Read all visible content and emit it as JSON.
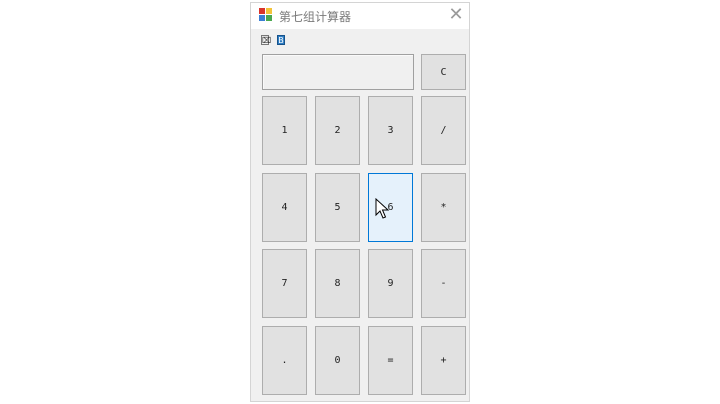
{
  "window": {
    "title": "第七组计算器",
    "close_symbol": "✕"
  },
  "menu": {
    "items": [
      "⌧",
      "B"
    ]
  },
  "display": {
    "value": ""
  },
  "clear_button": {
    "label": "C"
  },
  "keypad": {
    "rows": [
      [
        "1",
        "2",
        "3",
        "/"
      ],
      [
        "4",
        "5",
        "6",
        "*"
      ],
      [
        "7",
        "8",
        "9",
        "-"
      ],
      [
        ".",
        "0",
        "=",
        "+"
      ]
    ],
    "hovered": "6"
  }
}
